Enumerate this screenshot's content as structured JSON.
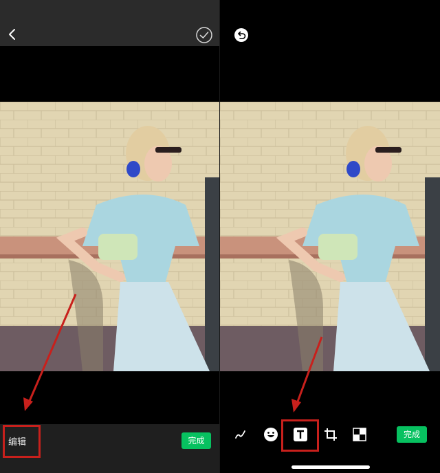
{
  "left_panel": {
    "bottom_bar": {
      "edit_label": "编辑",
      "done_label": "完成"
    }
  },
  "right_panel": {
    "toolbar": {
      "tools": [
        "pen-icon",
        "emoji-icon",
        "text-icon",
        "crop-icon",
        "mosaic-icon"
      ],
      "done_label": "完成"
    }
  },
  "colors": {
    "accent_green": "#07c160",
    "highlight_red": "#c8201c"
  }
}
